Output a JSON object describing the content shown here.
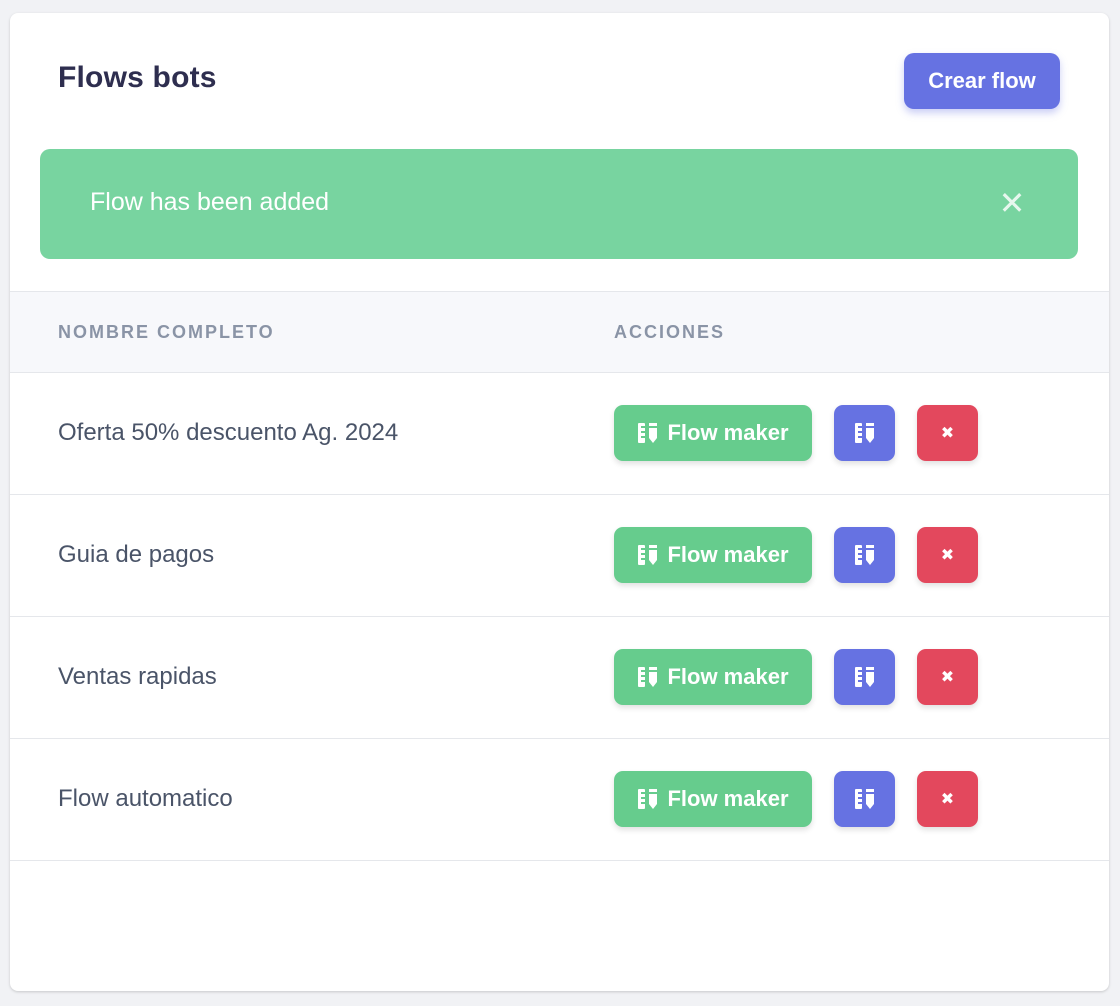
{
  "header": {
    "title": "Flows bots",
    "create_label": "Crear flow"
  },
  "alert": {
    "message": "Flow has been added",
    "close_icon": "close-icon"
  },
  "table": {
    "columns": [
      "NOMBRE COMPLETO",
      "ACCIONES"
    ],
    "rows": [
      {
        "name": "Oferta 50% descuento Ag. 2024",
        "flow_maker_label": "Flow maker"
      },
      {
        "name": "Guia de pagos",
        "flow_maker_label": "Flow maker"
      },
      {
        "name": "Ventas rapidas",
        "flow_maker_label": "Flow maker"
      },
      {
        "name": "Flow automatico",
        "flow_maker_label": "Flow maker"
      }
    ]
  },
  "icons": {
    "flow_maker": "ruler-pencil-icon",
    "edit": "ruler-pencil-icon",
    "delete": "close-icon"
  },
  "colors": {
    "primary": "#6672e2",
    "success": "#66cc8d",
    "alert_bg": "#78d4a0",
    "danger": "#e3485d",
    "title": "#2e2e4f"
  }
}
